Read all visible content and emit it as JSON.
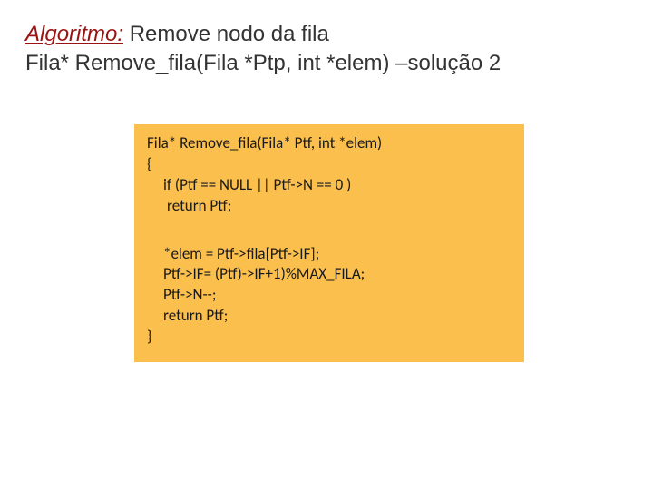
{
  "title": {
    "algo_label": "Algoritmo:",
    "rest_line1": " Remove  nodo da fila",
    "line2": "Fila* Remove_fila(Fila *Ptp, int *elem) –solução 2"
  },
  "code": {
    "l1": "Fila* Remove_fila(Fila* Ptf, int *elem)",
    "l2": "{",
    "l3": "if (Ptf == NULL || Ptf->N == 0  )",
    "l4": "return Ptf;",
    "l5": "*elem = Ptf->fila[Ptf->IF];",
    "l6": "Ptf->IF= (Ptf)->IF+1)%MAX_FILA;",
    "l7": "Ptf->N--;",
    "l8": "return Ptf;",
    "l9": "}"
  }
}
